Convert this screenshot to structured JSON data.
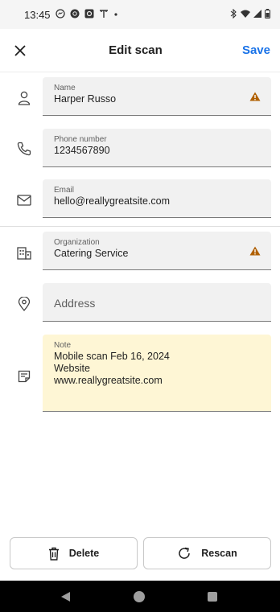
{
  "status_bar": {
    "time": "13:45",
    "left_icons": [
      "messenger-icon",
      "instagram-icon",
      "camera-icon",
      "antenna-icon",
      "dot-icon"
    ],
    "right_icons": [
      "bluetooth-icon",
      "wifi-icon",
      "signal-icon",
      "battery-icon"
    ]
  },
  "topbar": {
    "close_icon": "close-icon",
    "title": "Edit scan",
    "save_label": "Save",
    "save_color": "#1a73e8"
  },
  "fields": {
    "name": {
      "label": "Name",
      "value": "Harper Russo",
      "icon": "person-icon",
      "warning": true
    },
    "phone": {
      "label": "Phone number",
      "value": "1234567890",
      "icon": "phone-icon"
    },
    "email": {
      "label": "Email",
      "value": "hello@reallygreatsite.com",
      "icon": "mail-icon"
    },
    "organization": {
      "label": "Organization",
      "value": "Catering Service",
      "icon": "building-icon",
      "warning": true
    },
    "address": {
      "placeholder": "Address",
      "icon": "location-pin-icon"
    },
    "note": {
      "label": "Note",
      "lines": [
        "Mobile scan Feb 16, 2024",
        "Website",
        "www.reallygreatsite.com"
      ],
      "icon": "note-icon",
      "background": "#fef6d5"
    }
  },
  "warning_color": "#b06000",
  "actions": {
    "delete_label": "Delete",
    "rescan_label": "Rescan"
  },
  "nav_bar": {
    "icons": [
      "back-icon",
      "home-icon",
      "recents-icon"
    ]
  }
}
